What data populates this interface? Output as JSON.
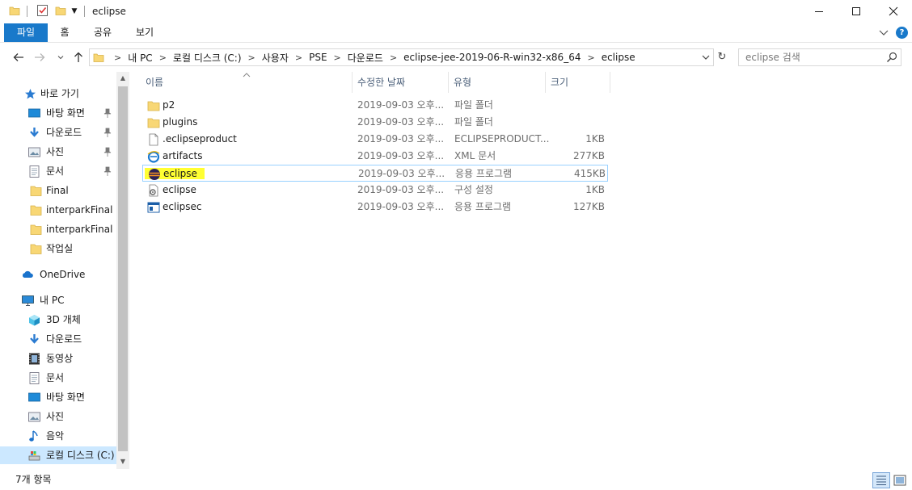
{
  "window": {
    "title": "eclipse",
    "minimize_label": "",
    "maximize_label": ""
  },
  "ribbon": {
    "tabs": [
      "파일",
      "홈",
      "공유",
      "보기"
    ]
  },
  "address_bar": {
    "crumbs": [
      "내 PC",
      "로컬 디스크 (C:)",
      "사용자",
      "PSE",
      "다운로드",
      "eclipse-jee-2019-06-R-win32-x86_64",
      "eclipse"
    ]
  },
  "search": {
    "placeholder": "eclipse 검색"
  },
  "sidebar": {
    "quick_access": "바로 가기",
    "pinned": [
      {
        "label": "바탕 화면",
        "icon": "desktop-icon"
      },
      {
        "label": "다운로드",
        "icon": "download-icon"
      },
      {
        "label": "사진",
        "icon": "pictures-icon"
      },
      {
        "label": "문서",
        "icon": "documents-icon"
      }
    ],
    "recent": [
      "Final",
      "interparkFinal",
      "interparkFinal",
      "작업실"
    ],
    "onedrive": "OneDrive",
    "this_pc": "내 PC",
    "pc_items": [
      {
        "label": "3D 개체",
        "icon": "3d-objects-icon"
      },
      {
        "label": "다운로드",
        "icon": "download-icon"
      },
      {
        "label": "동영상",
        "icon": "videos-icon"
      },
      {
        "label": "문서",
        "icon": "documents-icon"
      },
      {
        "label": "바탕 화면",
        "icon": "desktop-icon"
      },
      {
        "label": "사진",
        "icon": "pictures-icon"
      },
      {
        "label": "음악",
        "icon": "music-icon"
      },
      {
        "label": "로컬 디스크 (C:)",
        "icon": "local-disk-icon"
      }
    ]
  },
  "columns": {
    "name": "이름",
    "date": "수정한 날짜",
    "type": "유형",
    "size": "크기"
  },
  "files": [
    {
      "name": "p2",
      "date": "2019-09-03 오후...",
      "type": "파일 폴더",
      "size": "",
      "icon": "folder-icon"
    },
    {
      "name": "plugins",
      "date": "2019-09-03 오후...",
      "type": "파일 폴더",
      "size": "",
      "icon": "folder-icon"
    },
    {
      "name": ".eclipseproduct",
      "date": "2019-09-03 오후...",
      "type": "ECLIPSEPRODUCT...",
      "size": "1KB",
      "icon": "file-icon"
    },
    {
      "name": "artifacts",
      "date": "2019-09-03 오후...",
      "type": "XML 문서",
      "size": "277KB",
      "icon": "xml-document-icon"
    },
    {
      "name": "eclipse",
      "date": "2019-09-03 오후...",
      "type": "응용 프로그램",
      "size": "415KB",
      "icon": "eclipse-app-icon"
    },
    {
      "name": "eclipse",
      "date": "2019-09-03 오후...",
      "type": "구성 설정",
      "size": "1KB",
      "icon": "config-settings-icon"
    },
    {
      "name": "eclipsec",
      "date": "2019-09-03 오후...",
      "type": "응용 프로그램",
      "size": "127KB",
      "icon": "console-app-icon"
    }
  ],
  "status": {
    "item_count": "7개 항목"
  },
  "colors": {
    "accent": "#1979ca",
    "folder": "#f8d775",
    "selection": "#cce8ff",
    "highlight_marker": "#ffff33"
  }
}
